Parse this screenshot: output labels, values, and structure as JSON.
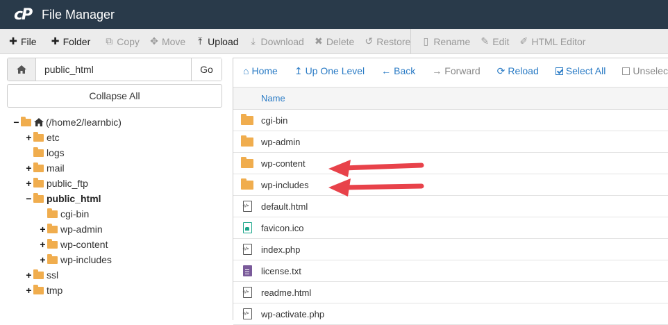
{
  "app": {
    "logo": "cP",
    "title": "File Manager"
  },
  "toolbar": [
    {
      "id": "file",
      "icon": "plus-icon",
      "glyph": "✚",
      "label": "File",
      "enabled": true
    },
    {
      "id": "folder",
      "icon": "plus-icon",
      "glyph": "✚",
      "label": "Folder",
      "enabled": true
    },
    {
      "id": "copy",
      "icon": "copy-icon",
      "glyph": "⧉",
      "label": "Copy",
      "enabled": false
    },
    {
      "id": "move",
      "icon": "move-icon",
      "glyph": "✥",
      "label": "Move",
      "enabled": false
    },
    {
      "id": "upload",
      "icon": "upload-icon",
      "glyph": "⤒",
      "label": "Upload",
      "enabled": true
    },
    {
      "id": "download",
      "icon": "download-icon",
      "glyph": "⤓",
      "label": "Download",
      "enabled": false
    },
    {
      "id": "delete",
      "icon": "close-icon",
      "glyph": "✖",
      "label": "Delete",
      "enabled": false
    },
    {
      "id": "restore",
      "icon": "undo-icon",
      "glyph": "↺",
      "label": "Restore",
      "enabled": false
    },
    {
      "id": "rename",
      "icon": "file-icon",
      "glyph": "▯",
      "label": "Rename",
      "enabled": false
    },
    {
      "id": "edit",
      "icon": "pencil-icon",
      "glyph": "✎",
      "label": "Edit",
      "enabled": false
    },
    {
      "id": "html-editor",
      "icon": "edit-icon",
      "glyph": "✐",
      "label": "HTML Editor",
      "enabled": false
    }
  ],
  "path": {
    "value": "public_html",
    "go_label": "Go"
  },
  "collapse_label": "Collapse All",
  "tree": [
    {
      "label": "(/home2/learnbic)",
      "toggle": "−",
      "icon": "folder-open-icon",
      "home": true,
      "depth": 0,
      "bold": false
    },
    {
      "label": "etc",
      "toggle": "+",
      "depth": 1
    },
    {
      "label": "logs",
      "toggle": "",
      "depth": 1
    },
    {
      "label": "mail",
      "toggle": "+",
      "depth": 1
    },
    {
      "label": "public_ftp",
      "toggle": "+",
      "depth": 1
    },
    {
      "label": "public_html",
      "toggle": "−",
      "depth": 1,
      "bold": true,
      "open": true
    },
    {
      "label": "cgi-bin",
      "toggle": "",
      "depth": 2
    },
    {
      "label": "wp-admin",
      "toggle": "+",
      "depth": 2
    },
    {
      "label": "wp-content",
      "toggle": "+",
      "depth": 2
    },
    {
      "label": "wp-includes",
      "toggle": "+",
      "depth": 2
    },
    {
      "label": "ssl",
      "toggle": "+",
      "depth": 1
    },
    {
      "label": "tmp",
      "toggle": "+",
      "depth": 1
    }
  ],
  "nav": [
    {
      "id": "home",
      "glyph": "⌂",
      "icon": "home-icon",
      "label": "Home",
      "enabled": true
    },
    {
      "id": "up-one-level",
      "glyph": "↥",
      "icon": "level-up-icon",
      "label": "Up One Level",
      "enabled": true
    },
    {
      "id": "back",
      "glyph": "←",
      "icon": "arrow-left-icon",
      "label": "Back",
      "enabled": true
    },
    {
      "id": "forward",
      "glyph": "→",
      "icon": "arrow-right-icon",
      "label": "Forward",
      "enabled": false
    },
    {
      "id": "reload",
      "glyph": "⟳",
      "icon": "refresh-icon",
      "label": "Reload",
      "enabled": true
    },
    {
      "id": "select-all",
      "glyph": "check",
      "icon": "checkbox-checked-icon",
      "label": "Select All",
      "enabled": true
    },
    {
      "id": "unselect-all",
      "glyph": "box",
      "icon": "checkbox-empty-icon",
      "label": "Unselect All",
      "enabled": false
    }
  ],
  "table": {
    "header_name": "Name",
    "rows": [
      {
        "name": "cgi-bin",
        "type": "folder"
      },
      {
        "name": "wp-admin",
        "type": "folder"
      },
      {
        "name": "wp-content",
        "type": "folder"
      },
      {
        "name": "wp-includes",
        "type": "folder"
      },
      {
        "name": "default.html",
        "type": "code"
      },
      {
        "name": "favicon.ico",
        "type": "image"
      },
      {
        "name": "index.php",
        "type": "code"
      },
      {
        "name": "license.txt",
        "type": "text"
      },
      {
        "name": "readme.html",
        "type": "code"
      },
      {
        "name": "wp-activate.php",
        "type": "code"
      }
    ]
  },
  "colors": {
    "titlebar": "#293a4a",
    "link": "#2a7bc5",
    "folder": "#f0ad4e",
    "annotation_arrow": "#e8424a"
  }
}
